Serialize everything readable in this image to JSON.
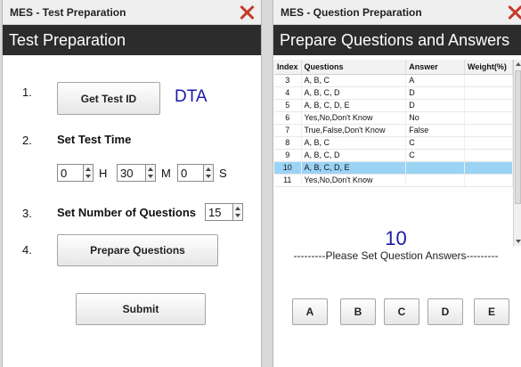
{
  "test_window": {
    "title": "MES - Test Preparation",
    "header": "Test Preparation",
    "step1": {
      "number": "1.",
      "button": "Get Test ID",
      "test_id": "DTA"
    },
    "step2": {
      "number": "2.",
      "label": "Set Test Time",
      "hours": "0",
      "hours_unit": "H",
      "minutes": "30",
      "minutes_unit": "M",
      "seconds": "0",
      "seconds_unit": "S"
    },
    "step3": {
      "number": "3.",
      "label": "Set Number of Questions",
      "value": "15"
    },
    "step4": {
      "number": "4.",
      "button": "Prepare Questions"
    },
    "submit": "Submit"
  },
  "question_window": {
    "title": "MES - Question Preparation",
    "header": "Prepare Questions and Answers",
    "table": {
      "columns": [
        "Index",
        "Questions",
        "Answer",
        "Weight(%)"
      ],
      "rows": [
        {
          "index": "3",
          "question": "A, B, C",
          "answer": "A",
          "weight": ""
        },
        {
          "index": "4",
          "question": "A, B, C, D",
          "answer": "D",
          "weight": ""
        },
        {
          "index": "5",
          "question": "A, B, C, D, E",
          "answer": "D",
          "weight": ""
        },
        {
          "index": "6",
          "question": "Yes,No,Don't Know",
          "answer": "No",
          "weight": ""
        },
        {
          "index": "7",
          "question": "True,False,Don't Know",
          "answer": "False",
          "weight": ""
        },
        {
          "index": "8",
          "question": "A, B, C",
          "answer": "C",
          "weight": ""
        },
        {
          "index": "9",
          "question": "A, B, C, D",
          "answer": "C",
          "weight": ""
        },
        {
          "index": "10",
          "question": "A, B, C, D, E",
          "answer": "",
          "weight": ""
        },
        {
          "index": "11",
          "question": "Yes,No,Don't Know",
          "answer": "",
          "weight": ""
        }
      ],
      "selected_index": "10"
    },
    "current_question": "10",
    "instruction": "---------Please Set Question Answers---------",
    "answer_buttons": [
      "A",
      "B",
      "C",
      "D",
      "E"
    ]
  },
  "colors": {
    "header_bg": "#2c2c2c",
    "accent_blue": "#1a1aa8",
    "selected_row": "#9bd3f5",
    "close_red": "#c63a2b"
  }
}
